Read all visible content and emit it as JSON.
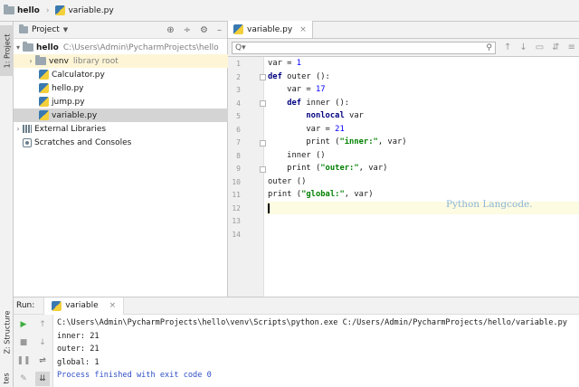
{
  "breadcrumb": {
    "project": "hello",
    "file": "variable.py"
  },
  "tool_strip": {
    "project_tab": "1: Project",
    "structure_tab": "Z: Structure",
    "favorites_tab": "tes"
  },
  "project_panel": {
    "title": "Project",
    "tree": [
      {
        "label": "hello",
        "path": "C:\\Users\\Admin\\PycharmProjects\\hello",
        "kind": "root",
        "expanded": true
      },
      {
        "label": "venv",
        "note": "library root",
        "kind": "folder",
        "expanded": false
      },
      {
        "label": "Calculator.py",
        "kind": "file"
      },
      {
        "label": "hello.py",
        "kind": "file"
      },
      {
        "label": "jump.py",
        "kind": "file"
      },
      {
        "label": "variable.py",
        "kind": "file",
        "selected": true
      },
      {
        "label": "External Libraries",
        "kind": "library",
        "expanded": false
      },
      {
        "label": "Scratches and Consoles",
        "kind": "scratch"
      }
    ]
  },
  "editor": {
    "tab_label": "variable.py",
    "search_placeholder": "Q▾",
    "line_numbers": [
      "1",
      "2",
      "3",
      "4",
      "5",
      "6",
      "7",
      "8",
      "9",
      "10",
      "11",
      "12",
      "13",
      "14"
    ],
    "current_line": 12,
    "watermark": "Python Langcode."
  },
  "run_panel": {
    "label": "Run:",
    "tab_label": "variable",
    "output": [
      "C:\\Users\\Admin\\PycharmProjects\\hello\\venv\\Scripts\\python.exe C:/Users/Admin/PycharmProjects/hello/variable.py",
      "inner: 21",
      "outer: 21",
      "global: 1",
      "",
      "Process finished with exit code 0"
    ]
  },
  "colors": {
    "keyword": "#000080",
    "string": "#008000",
    "number": "#0000ff",
    "selection": "#d4d4d4",
    "current_line": "#fdfbe1",
    "watermark": "#8ab4d8"
  }
}
